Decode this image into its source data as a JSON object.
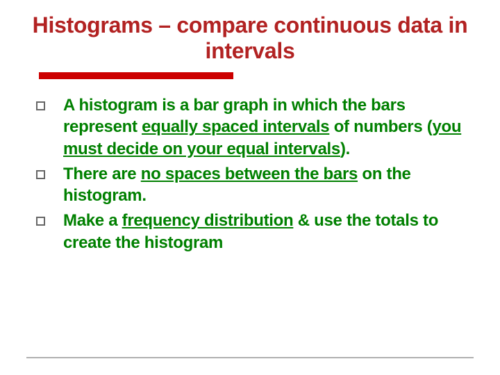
{
  "title": "Histograms – compare continuous data in intervals",
  "bullets": {
    "b1_pre": "A histogram is a bar graph in which the bars represent ",
    "b1_u1": "equally spaced intervals",
    "b1_mid": " of numbers (",
    "b1_u2": "you must decide on your equal intervals",
    "b1_post": ").",
    "b2_pre": "There are ",
    "b2_u1": "no spaces between the bars",
    "b2_post": " on the histogram.",
    "b3_pre": "Make a ",
    "b3_u1": "frequency distribution",
    "b3_post": " & use the totals to create the histogram"
  }
}
